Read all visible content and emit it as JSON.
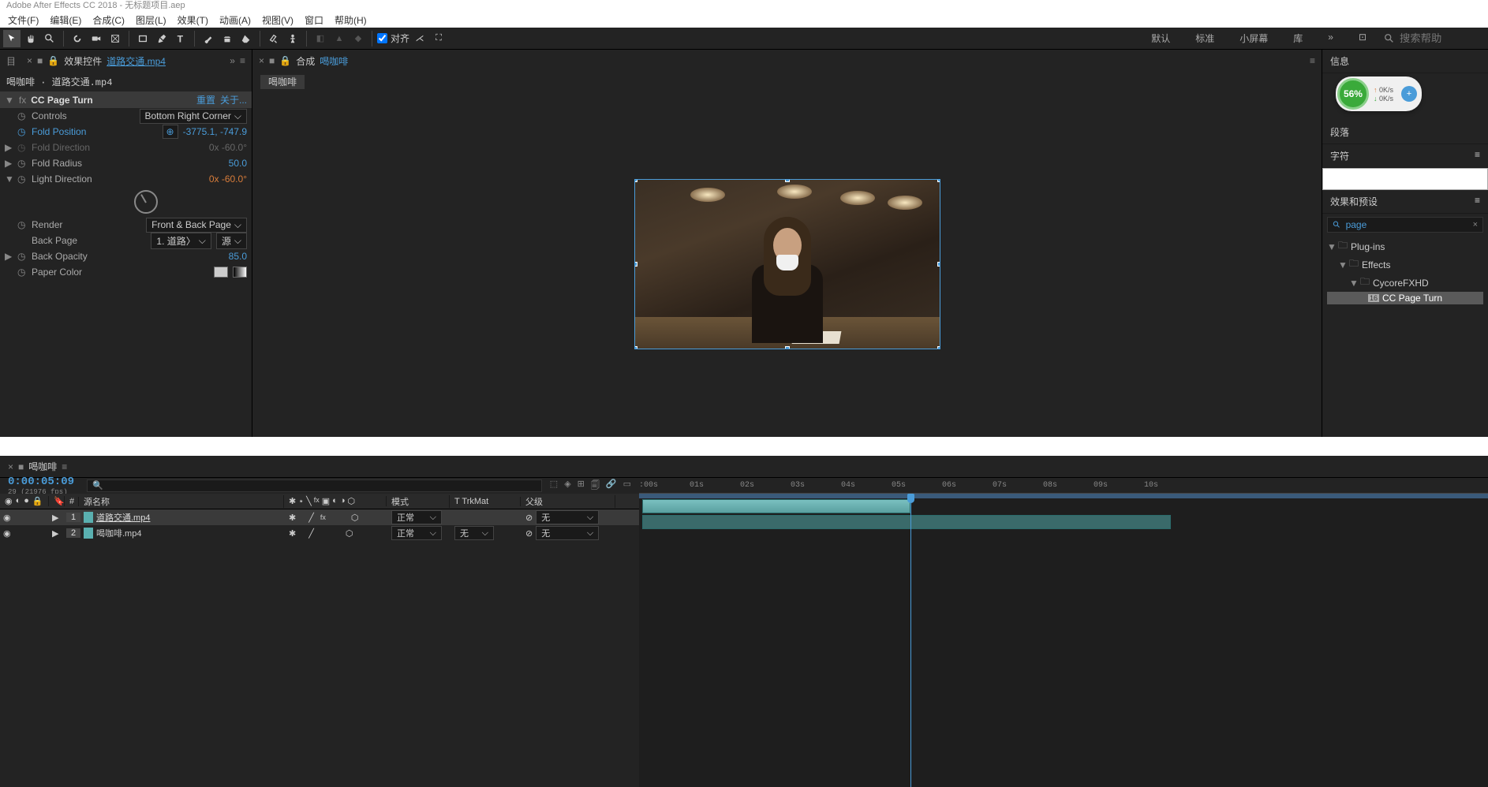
{
  "titlebar": "Adobe After Effects CC 2018 - 无标题项目.aep",
  "menu": [
    "文件(F)",
    "编辑(E)",
    "合成(C)",
    "图层(L)",
    "效果(T)",
    "动画(A)",
    "视图(V)",
    "窗口",
    "帮助(H)"
  ],
  "toolbar": {
    "align": "对齐"
  },
  "workspaces": [
    "默认",
    "标准",
    "小屏幕",
    "库"
  ],
  "search_help_placeholder": "搜索帮助",
  "left": {
    "tab_prefix": "目",
    "tab_label": "效果控件",
    "tab_file": "道路交通.mp4",
    "breadcrumb": "喝咖啡 · 道路交通.mp4",
    "effect_name": "CC Page Turn",
    "reset": "重置",
    "about": "关于...",
    "props": {
      "controls": "Controls",
      "controls_val": "Bottom Right Corner",
      "fold_position": "Fold Position",
      "fold_position_val": "-3775.1, -747.9",
      "fold_direction": "Fold Direction",
      "fold_direction_val": "0x -60.0°",
      "fold_radius": "Fold Radius",
      "fold_radius_val": "50.0",
      "light_direction": "Light Direction",
      "light_direction_val": "0x -60.0°",
      "render": "Render",
      "render_val": "Front & Back Page",
      "back_page": "Back Page",
      "back_page_val": "1. 道路〉",
      "back_page_src": "源",
      "back_opacity": "Back Opacity",
      "back_opacity_val": "85.0",
      "paper_color": "Paper Color"
    }
  },
  "center": {
    "tab_label": "合成",
    "tab_name": "喝咖啡",
    "nav": "喝咖啡"
  },
  "right": {
    "info": "信息",
    "paragraph": "段落",
    "char": "字符",
    "effects_presets": "效果和预设",
    "search_val": "page",
    "tree": {
      "plugins": "Plug-ins",
      "effects": "Effects",
      "cycore": "CycoreFXHD",
      "cc_page_turn": "CC Page Turn",
      "badge": "16"
    }
  },
  "timeline": {
    "tab": "喝咖啡",
    "timecode": "0:00:05:09",
    "fps": "29 (21976 fps)",
    "cols": {
      "idx": "#",
      "source": "源名称",
      "mode": "模式",
      "trkmat": "T  TrkMat",
      "parent": "父级"
    },
    "layers": [
      {
        "num": "1",
        "color": "#5ab0b0",
        "name": "道路交通.mp4",
        "mode": "正常",
        "trkmat": "",
        "parent": "无"
      },
      {
        "num": "2",
        "color": "#5ab0b0",
        "name": "喝咖啡.mp4",
        "mode": "正常",
        "trkmat": "无",
        "parent": "无"
      }
    ],
    "ticks": [
      ":00s",
      "01s",
      "02s",
      "03s",
      "04s",
      "05s",
      "06s",
      "07s",
      "08s",
      "09s",
      "10s"
    ]
  },
  "badge": {
    "pct": "56%",
    "up": "0K/s",
    "down": "0K/s"
  }
}
